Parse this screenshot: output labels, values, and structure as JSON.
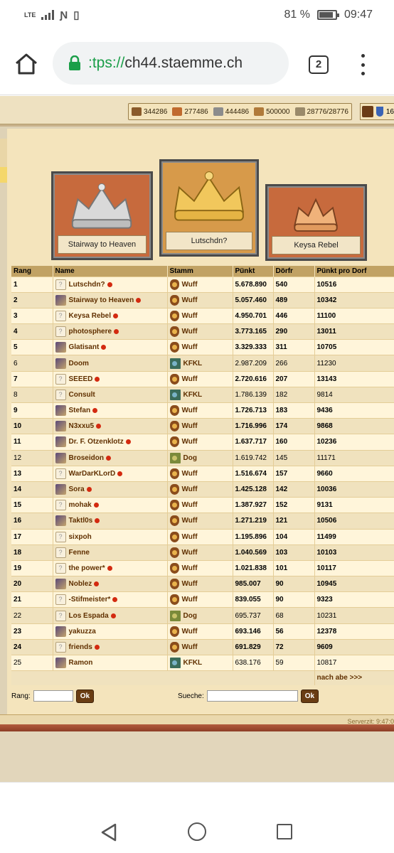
{
  "status": {
    "battery": "81 %",
    "time": "09:47",
    "lte": "LTE"
  },
  "browser": {
    "url_scheme": ":tps://",
    "url_host": "ch44.staemme.ch",
    "tab_count": "2"
  },
  "resources": [
    {
      "icon": "wood-icon",
      "value": "344286",
      "color": "#8a5a2a"
    },
    {
      "icon": "clay-icon",
      "value": "277486",
      "color": "#c06a2e"
    },
    {
      "icon": "iron-icon",
      "value": "444486",
      "color": "#8c8c8c"
    },
    {
      "icon": "storage-icon",
      "value": "500000",
      "color": "#b07a3a"
    },
    {
      "icon": "population-icon",
      "value": "28776/28776",
      "color": "#9a8a6a"
    }
  ],
  "extra_value": "16",
  "podium": {
    "first": "Lutschdn?",
    "second": "Stairway to Heaven",
    "third": "Keysa Rebel"
  },
  "table": {
    "headers": {
      "rank": "Rang",
      "name": "Name",
      "tribe": "Stamm",
      "points": "Pünkt",
      "villages": "Dörfr",
      "ppv": "Pünkt pro Dorf"
    },
    "rows": [
      {
        "rank": "1",
        "name": "Lutschdn?",
        "dot": true,
        "avatar": "placeholder",
        "tribe": "Wuff",
        "tribe_icon": "wuff",
        "points": "5.678.890",
        "villages": "540",
        "ppv": "10516",
        "bold": true
      },
      {
        "rank": "2",
        "name": "Stairway to Heaven",
        "dot": true,
        "avatar": "image",
        "tribe": "Wuff",
        "tribe_icon": "wuff",
        "points": "5.057.460",
        "villages": "489",
        "ppv": "10342",
        "bold": true
      },
      {
        "rank": "3",
        "name": "Keysa Rebel",
        "dot": true,
        "avatar": "placeholder",
        "tribe": "Wuff",
        "tribe_icon": "wuff",
        "points": "4.950.701",
        "villages": "446",
        "ppv": "11100",
        "bold": true
      },
      {
        "rank": "4",
        "name": "photosphere",
        "dot": true,
        "avatar": "placeholder",
        "tribe": "Wuff",
        "tribe_icon": "wuff",
        "points": "3.773.165",
        "villages": "290",
        "ppv": "13011",
        "bold": true
      },
      {
        "rank": "5",
        "name": "Glatisant",
        "dot": true,
        "avatar": "image",
        "tribe": "Wuff",
        "tribe_icon": "wuff",
        "points": "3.329.333",
        "villages": "311",
        "ppv": "10705",
        "bold": true
      },
      {
        "rank": "6",
        "name": "Doom",
        "dot": false,
        "avatar": "image",
        "tribe": "KFKL",
        "tribe_icon": "kfkl",
        "points": "2.987.209",
        "villages": "266",
        "ppv": "11230",
        "bold": false
      },
      {
        "rank": "7",
        "name": "SEEED",
        "dot": true,
        "avatar": "placeholder",
        "tribe": "Wuff",
        "tribe_icon": "wuff",
        "points": "2.720.616",
        "villages": "207",
        "ppv": "13143",
        "bold": true
      },
      {
        "rank": "8",
        "name": "Consult",
        "dot": false,
        "avatar": "placeholder",
        "tribe": "KFKL",
        "tribe_icon": "kfkl",
        "points": "1.786.139",
        "villages": "182",
        "ppv": "9814",
        "bold": false
      },
      {
        "rank": "9",
        "name": "Stefan",
        "dot": true,
        "avatar": "image",
        "tribe": "Wuff",
        "tribe_icon": "wuff",
        "points": "1.726.713",
        "villages": "183",
        "ppv": "9436",
        "bold": true
      },
      {
        "rank": "10",
        "name": "N3xxu5",
        "dot": true,
        "avatar": "image",
        "tribe": "Wuff",
        "tribe_icon": "wuff",
        "points": "1.716.996",
        "villages": "174",
        "ppv": "9868",
        "bold": true
      },
      {
        "rank": "11",
        "name": "Dr. F. Otzenklotz",
        "dot": true,
        "avatar": "image",
        "tribe": "Wuff",
        "tribe_icon": "wuff",
        "points": "1.637.717",
        "villages": "160",
        "ppv": "10236",
        "bold": true
      },
      {
        "rank": "12",
        "name": "Broseidon",
        "dot": true,
        "avatar": "image",
        "tribe": "Dog",
        "tribe_icon": "dog",
        "points": "1.619.742",
        "villages": "145",
        "ppv": "11171",
        "bold": false
      },
      {
        "rank": "13",
        "name": "WarDarKLorD",
        "dot": true,
        "avatar": "placeholder",
        "tribe": "Wuff",
        "tribe_icon": "wuff",
        "points": "1.516.674",
        "villages": "157",
        "ppv": "9660",
        "bold": true
      },
      {
        "rank": "14",
        "name": "Sora",
        "dot": true,
        "avatar": "image",
        "tribe": "Wuff",
        "tribe_icon": "wuff",
        "points": "1.425.128",
        "villages": "142",
        "ppv": "10036",
        "bold": true
      },
      {
        "rank": "15",
        "name": "mohak",
        "dot": true,
        "avatar": "placeholder",
        "tribe": "Wuff",
        "tribe_icon": "wuff",
        "points": "1.387.927",
        "villages": "152",
        "ppv": "9131",
        "bold": true
      },
      {
        "rank": "16",
        "name": "Taktl0s",
        "dot": true,
        "avatar": "image",
        "tribe": "Wuff",
        "tribe_icon": "wuff",
        "points": "1.271.219",
        "villages": "121",
        "ppv": "10506",
        "bold": true
      },
      {
        "rank": "17",
        "name": "sixpoh",
        "dot": false,
        "avatar": "placeholder",
        "tribe": "Wuff",
        "tribe_icon": "wuff",
        "points": "1.195.896",
        "villages": "104",
        "ppv": "11499",
        "bold": true
      },
      {
        "rank": "18",
        "name": "Fenne",
        "dot": false,
        "avatar": "placeholder",
        "tribe": "Wuff",
        "tribe_icon": "wuff",
        "points": "1.040.569",
        "villages": "103",
        "ppv": "10103",
        "bold": true
      },
      {
        "rank": "19",
        "name": "the power*",
        "dot": true,
        "avatar": "placeholder",
        "tribe": "Wuff",
        "tribe_icon": "wuff",
        "points": "1.021.838",
        "villages": "101",
        "ppv": "10117",
        "bold": true
      },
      {
        "rank": "20",
        "name": "Noblez",
        "dot": true,
        "avatar": "image",
        "tribe": "Wuff",
        "tribe_icon": "wuff",
        "points": "985.007",
        "villages": "90",
        "ppv": "10945",
        "bold": true
      },
      {
        "rank": "21",
        "name": "-Stifmeister*",
        "dot": true,
        "avatar": "placeholder",
        "tribe": "Wuff",
        "tribe_icon": "wuff",
        "points": "839.055",
        "villages": "90",
        "ppv": "9323",
        "bold": true
      },
      {
        "rank": "22",
        "name": "Los Espada",
        "dot": true,
        "avatar": "placeholder",
        "tribe": "Dog",
        "tribe_icon": "dog",
        "points": "695.737",
        "villages": "68",
        "ppv": "10231",
        "bold": false
      },
      {
        "rank": "23",
        "name": "yakuzza",
        "dot": false,
        "avatar": "image",
        "tribe": "Wuff",
        "tribe_icon": "wuff",
        "points": "693.146",
        "villages": "56",
        "ppv": "12378",
        "bold": true
      },
      {
        "rank": "24",
        "name": "friends",
        "dot": true,
        "avatar": "placeholder",
        "tribe": "Wuff",
        "tribe_icon": "wuff",
        "points": "691.829",
        "villages": "72",
        "ppv": "9609",
        "bold": true
      },
      {
        "rank": "25",
        "name": "Ramon",
        "dot": false,
        "avatar": "image",
        "tribe": "KFKL",
        "tribe_icon": "kfkl",
        "points": "638.176",
        "villages": "59",
        "ppv": "10817",
        "bold": false
      }
    ],
    "next_link": "nach abe >>>"
  },
  "search": {
    "rank_label": "Rang:",
    "search_label": "Sueche:",
    "ok_label": "Ok",
    "rank_value": "",
    "search_value": ""
  },
  "server_time": "Serverzit: 9:47:0"
}
